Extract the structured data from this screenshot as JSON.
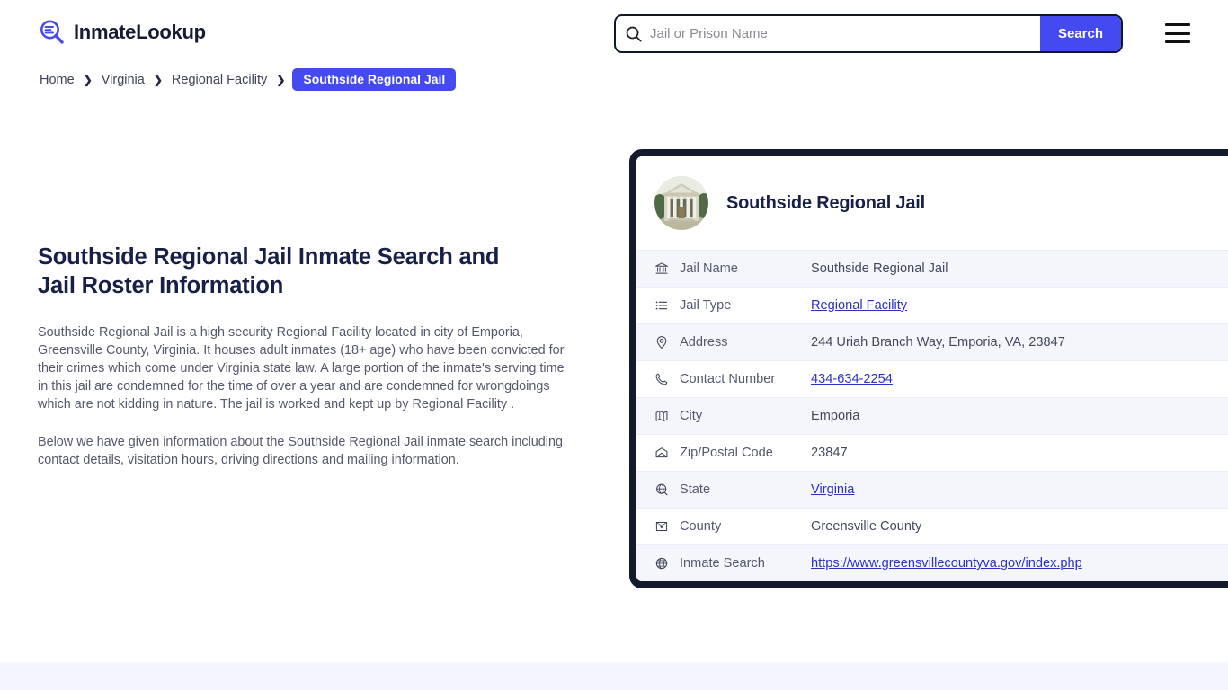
{
  "header": {
    "brand_name": "InmateLookup",
    "brand_icon": "magnifier-list-icon",
    "search": {
      "placeholder": "Jail or Prison Name",
      "value": "",
      "icon": "search-icon",
      "button_label": "Search"
    },
    "menu_icon": "hamburger-menu-icon",
    "accent_color": "#4449f0"
  },
  "breadcrumb": {
    "items": [
      {
        "label": "Home",
        "current": false
      },
      {
        "label": "Virginia",
        "current": false
      },
      {
        "label": "Regional Facility",
        "current": false
      },
      {
        "label": "Southside Regional Jail",
        "current": true
      }
    ],
    "separator": "❯"
  },
  "main": {
    "title": "Southside Regional Jail Inmate Search and Jail Roster Information",
    "paragraph_1": "Southside Regional Jail is a high security Regional Facility located in city of Emporia, Greensville County, Virginia. It houses adult inmates (18+ age) who have been convicted for their crimes which come under Virginia state law. A large portion of the inmate's serving time in this jail are condemned for the time of over a year and are condemned for wrongdoings which are not kidding in nature. The jail is worked and kept up by Regional Facility .",
    "paragraph_2": "Below we have given information about the Southside Regional Jail inmate search including contact details, visitation hours, driving directions and mailing information."
  },
  "info_card": {
    "avatar_icon": "courthouse-building-photo",
    "title": "Southside Regional Jail",
    "border_color": "#131a2e",
    "rows": [
      {
        "icon": "bank-icon",
        "label": "Jail Name",
        "value": "Southside Regional Jail",
        "link": false
      },
      {
        "icon": "list-icon",
        "label": "Jail Type",
        "value": "Regional Facility",
        "link": true
      },
      {
        "icon": "map-pin-icon",
        "label": "Address",
        "value": "244 Uriah Branch Way, Emporia, VA, 23847",
        "link": false
      },
      {
        "icon": "phone-icon",
        "label": "Contact Number",
        "value": "434-634-2254",
        "link": true
      },
      {
        "icon": "map-icon",
        "label": "City",
        "value": "Emporia",
        "link": false
      },
      {
        "icon": "envelope-icon",
        "label": "Zip/Postal Code",
        "value": "23847",
        "link": false
      },
      {
        "icon": "globe-stand-icon",
        "label": "State",
        "value": "Virginia",
        "link": true
      },
      {
        "icon": "location-card-icon",
        "label": "County",
        "value": "Greensville County",
        "link": false
      },
      {
        "icon": "globe-icon",
        "label": "Inmate Search",
        "value": "https://www.greensvillecountyva.gov/index.php",
        "link": true
      }
    ]
  },
  "footer_band": {
    "color": "#f5f5fd"
  }
}
